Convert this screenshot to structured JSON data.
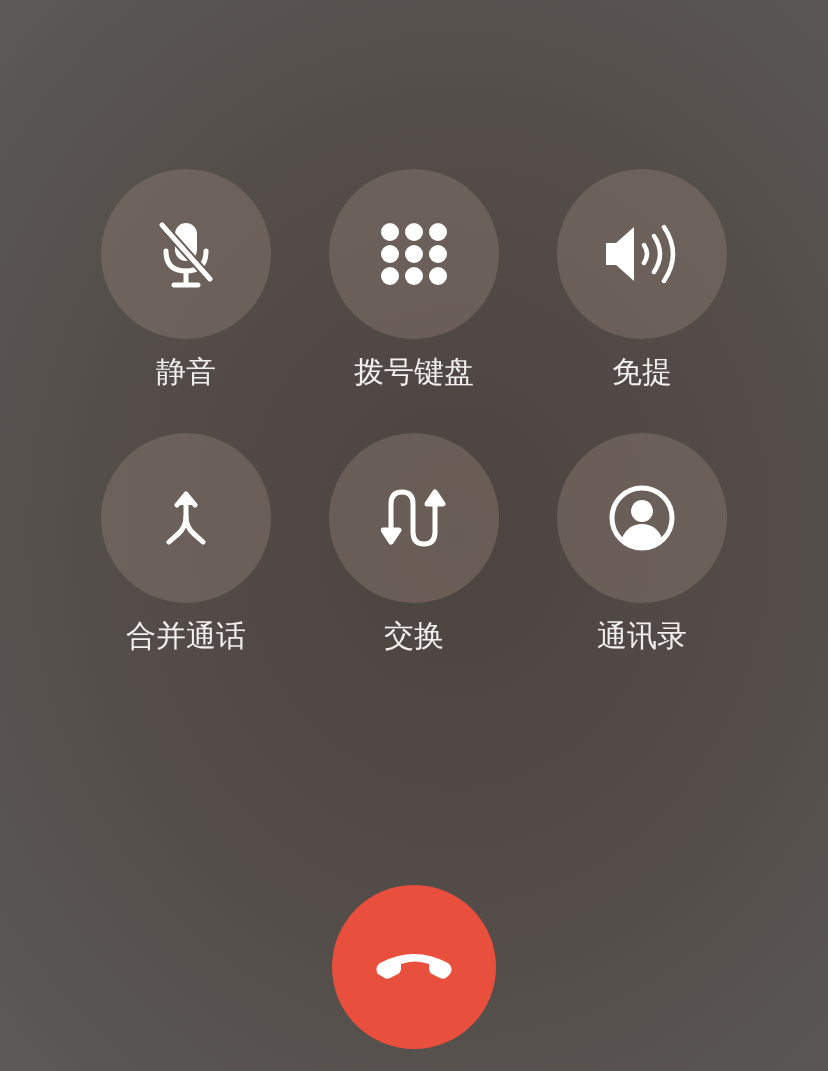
{
  "controls": [
    {
      "label": "静音",
      "kind": "mute"
    },
    {
      "label": "拨号键盘",
      "kind": "keypad"
    },
    {
      "label": "免提",
      "kind": "speaker"
    },
    {
      "label": "合并通话",
      "kind": "merge"
    },
    {
      "label": "交换",
      "kind": "swap"
    },
    {
      "label": "通讯录",
      "kind": "contacts"
    }
  ],
  "end_call": {
    "kind": "hangup"
  }
}
